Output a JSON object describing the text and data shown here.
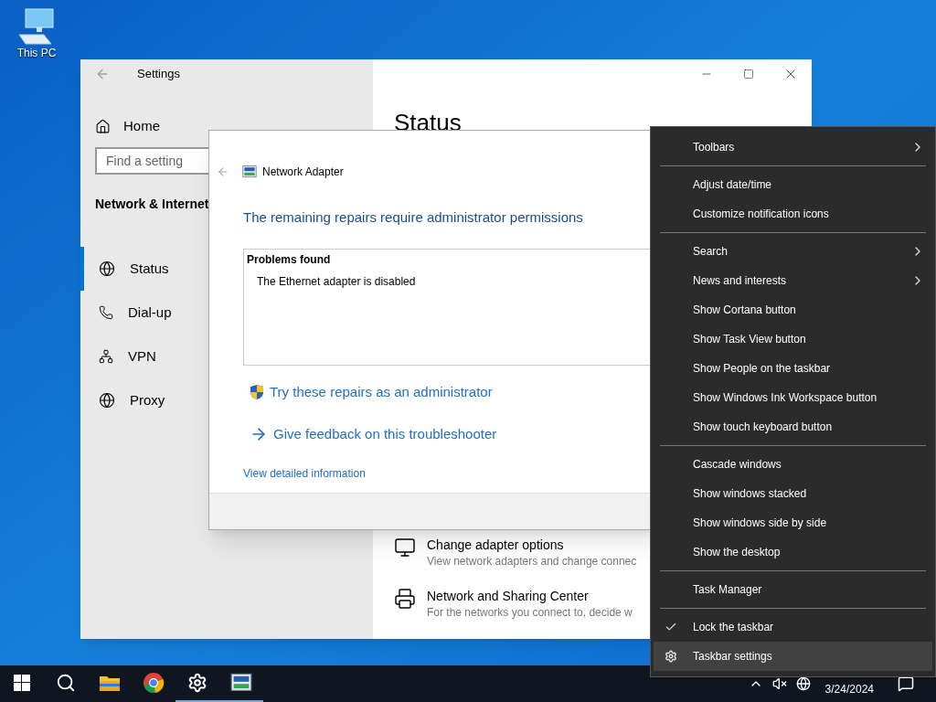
{
  "desktop_icons": [
    {
      "label": "This PC"
    }
  ],
  "settings_window": {
    "title": "Settings",
    "home": "Home",
    "search": {
      "placeholder": "Find a setting"
    },
    "section": "Network & Internet",
    "nav_items": [
      {
        "kind": "status",
        "label": "Status",
        "selected": true
      },
      {
        "kind": "dialup",
        "label": "Dial-up",
        "selected": false
      },
      {
        "kind": "vpn",
        "label": "VPN",
        "selected": false
      },
      {
        "kind": "proxy",
        "label": "Proxy",
        "selected": false
      }
    ],
    "page_title": "Status",
    "links": [
      {
        "kind": "adapter",
        "title": "Change adapter options",
        "description": "View network adapters and change connec"
      },
      {
        "kind": "sharing",
        "title": "Network and Sharing Center",
        "description": "For the networks you connect to, decide w"
      }
    ]
  },
  "troubleshooter": {
    "title": "Network Adapter",
    "heading": "The remaining repairs require administrator permissions",
    "problems_title": "Problems found",
    "problems": [
      "The Ethernet adapter is disabled"
    ],
    "actions": [
      {
        "kind": "admin",
        "label": "Try these repairs as an administrator"
      },
      {
        "kind": "feedback",
        "label": "Give feedback on this troubleshooter"
      }
    ],
    "details_link": "View detailed information"
  },
  "context_menu": {
    "groups": [
      [
        {
          "kind": "submenu",
          "label": "Toolbars",
          "checked": false,
          "selected": false
        }
      ],
      [
        {
          "kind": "command",
          "label": "Adjust date/time",
          "checked": false,
          "selected": false
        },
        {
          "kind": "command",
          "label": "Customize notification icons",
          "checked": false,
          "selected": false
        }
      ],
      [
        {
          "kind": "submenu",
          "label": "Search",
          "checked": false,
          "selected": false
        },
        {
          "kind": "submenu",
          "label": "News and interests",
          "checked": false,
          "selected": false
        },
        {
          "kind": "command",
          "label": "Show Cortana button",
          "checked": false,
          "selected": false
        },
        {
          "kind": "command",
          "label": "Show Task View button",
          "checked": false,
          "selected": false
        },
        {
          "kind": "command",
          "label": "Show People on the taskbar",
          "checked": false,
          "selected": false
        },
        {
          "kind": "command",
          "label": "Show Windows Ink Workspace button",
          "checked": false,
          "selected": false
        },
        {
          "kind": "command",
          "label": "Show touch keyboard button",
          "checked": false,
          "selected": false
        }
      ],
      [
        {
          "kind": "command",
          "label": "Cascade windows",
          "checked": false,
          "selected": false
        },
        {
          "kind": "command",
          "label": "Show windows stacked",
          "checked": false,
          "selected": false
        },
        {
          "kind": "command",
          "label": "Show windows side by side",
          "checked": false,
          "selected": false
        },
        {
          "kind": "command",
          "label": "Show the desktop",
          "checked": false,
          "selected": false
        }
      ],
      [
        {
          "kind": "command",
          "label": "Task Manager",
          "checked": false,
          "selected": false
        }
      ],
      [
        {
          "kind": "command",
          "label": "Lock the taskbar",
          "checked": true,
          "selected": false
        },
        {
          "kind": "settings",
          "label": "Taskbar settings",
          "checked": false,
          "selected": true
        }
      ]
    ]
  },
  "taskbar": {
    "items": [
      {
        "kind": "start",
        "running": false
      },
      {
        "kind": "search",
        "running": false
      },
      {
        "kind": "explorer",
        "running": false
      },
      {
        "kind": "browser",
        "running": false
      },
      {
        "kind": "settings",
        "running": true
      },
      {
        "kind": "adapter",
        "running": true
      }
    ],
    "date": "3/24/2024"
  }
}
